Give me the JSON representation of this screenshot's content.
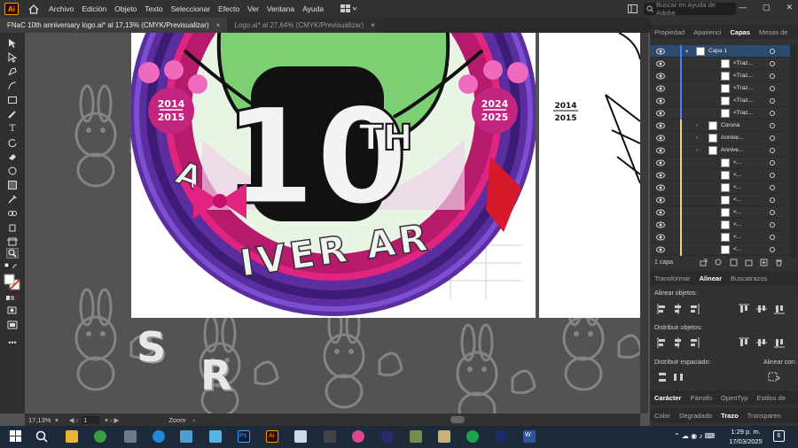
{
  "app": {
    "logo": "Ai",
    "home_icon": "home-icon"
  },
  "menu": [
    "Archivo",
    "Edición",
    "Objeto",
    "Texto",
    "Seleccionar",
    "Efecto",
    "Ver",
    "Ventana",
    "Ayuda"
  ],
  "help_search": {
    "placeholder": "Buscar en Ayuda de Adobe"
  },
  "window_controls": {
    "minimize": "—",
    "restore": "▢",
    "close": "✕"
  },
  "tabs": [
    {
      "label": "FNaC 10th anniversary logo.ai* al 17,13% (CMYK/Previsualizar)",
      "close": "×",
      "active": true
    },
    {
      "label": "Logo.ai* al 27,64% (CMYK/Previsualizar)",
      "close": "×",
      "active": false
    }
  ],
  "status": {
    "zoom": "17,13%",
    "artboard": "1",
    "tool": "Zoom"
  },
  "artwork": {
    "years_left_top": "2014",
    "years_left_bottom": "2015",
    "years_right_top": "2024",
    "years_right_bottom": "2025",
    "big_number": "10",
    "suffix": "TH",
    "arc_text_left": "A",
    "arc_text_bottom": "IVER AR",
    "artboard2_years_top": "2014",
    "artboard2_years_bottom": "2015",
    "pasteboard_letter_1": "S",
    "pasteboard_letter_2": "R"
  },
  "panel": {
    "top_tabs": [
      "Propiedad",
      "Aparienci",
      "Capas",
      "Mesas de"
    ],
    "active_top_tab": "Capas",
    "layers": [
      {
        "name": "Capa 1",
        "indent": 0,
        "bar": "#4b7bff"
      },
      {
        "name": "<Traz...",
        "indent": 2,
        "bar": "#4b7bff"
      },
      {
        "name": "<Traz...",
        "indent": 2,
        "bar": "#4b7bff"
      },
      {
        "name": "<Traz...",
        "indent": 2,
        "bar": "#4b7bff"
      },
      {
        "name": "<Traz...",
        "indent": 2,
        "bar": "#4b7bff"
      },
      {
        "name": "<Traz...",
        "indent": 2,
        "bar": "#4b7bff"
      },
      {
        "name": "Corona",
        "indent": 1,
        "bar": "#f2d84a"
      },
      {
        "name": "Annive...",
        "indent": 1,
        "bar": "#f2d84a"
      },
      {
        "name": "Annive...",
        "indent": 1,
        "bar": "#f2d84a"
      },
      {
        "name": "<...",
        "indent": 2,
        "bar": "#f2d84a"
      },
      {
        "name": "<...",
        "indent": 2,
        "bar": "#f2d84a"
      },
      {
        "name": "<...",
        "indent": 2,
        "bar": "#f2d84a"
      },
      {
        "name": "<...",
        "indent": 2,
        "bar": "#f2d84a"
      },
      {
        "name": "<...",
        "indent": 2,
        "bar": "#f2d84a"
      },
      {
        "name": "<...",
        "indent": 2,
        "bar": "#f2d84a"
      },
      {
        "name": "<...",
        "indent": 2,
        "bar": "#f2d84a"
      },
      {
        "name": "<...",
        "indent": 2,
        "bar": "#f2d84a"
      }
    ],
    "layer_count": "1 capa",
    "mid_tabs": [
      "Transformar",
      "Alinear",
      "Buscatrazos"
    ],
    "active_mid_tab": "Alinear",
    "align_objects": "Alinear objetos:",
    "distribute_objects": "Distribuir objetos:",
    "distribute_spacing": "Distribuir espaciado:",
    "align_with": "Alinear con:",
    "bottom_tabs_1": [
      "Carácter",
      "Párrafo",
      "OpenTyp",
      "Estilos de"
    ],
    "bottom_tabs_2": [
      "Color",
      "Degradado",
      "Trazo",
      "Transparen"
    ]
  },
  "taskbar": {
    "time": "1:29 p. m.",
    "date": "17/03/2025",
    "notification_count": "6"
  },
  "colors": {
    "purple": "#5b2d9e",
    "pink": "#e0247f",
    "green": "#7ccf72",
    "red": "#d6192b",
    "ui_dark": "#323232"
  }
}
